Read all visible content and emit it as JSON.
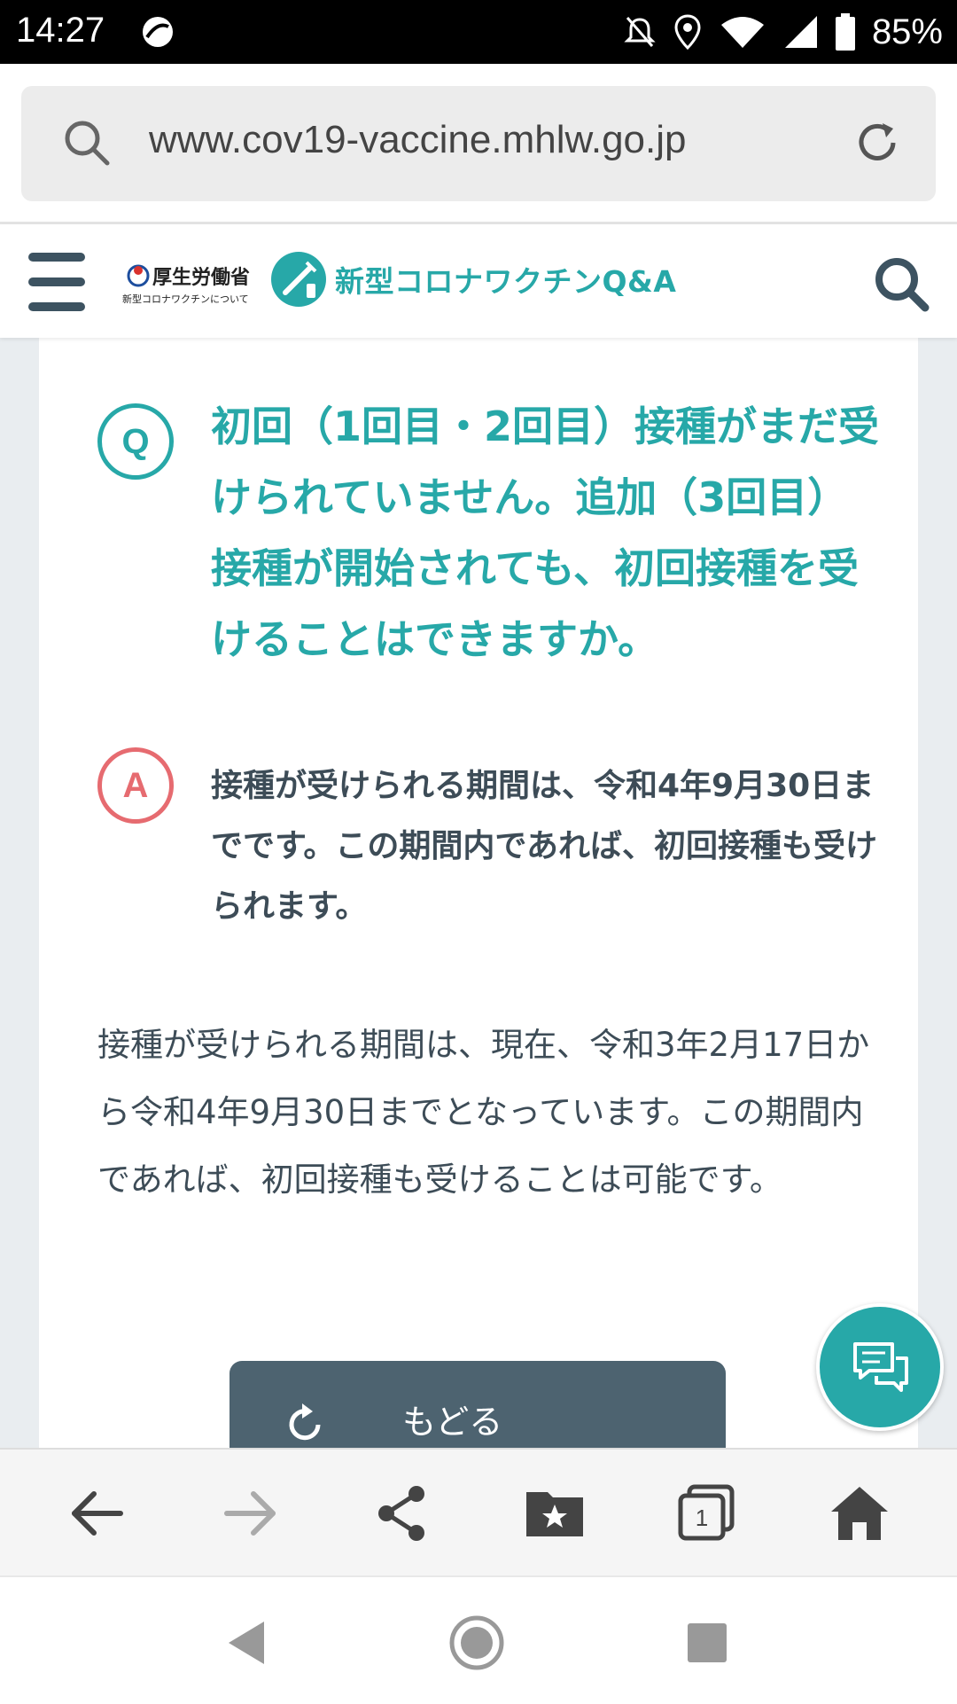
{
  "status_bar": {
    "time": "14:27",
    "battery": "85%"
  },
  "browser": {
    "url": "www.cov19-vaccine.mhlw.go.jp"
  },
  "site_header": {
    "mhlw_name": "厚生労働省",
    "mhlw_sub": "新型コロナワクチンについて",
    "site_title": "新型コロナワクチンQ&A"
  },
  "qa": {
    "q_badge": "Q",
    "question": "初回（1回目・2回目）接種がまだ受けられていません。追加（3回目）接種が開始されても、初回接種を受けることはできますか。",
    "a_badge": "A",
    "answer_lead": "接種が受けられる期間は、令和4年9月30日までです。この期間内であれば、初回接種も受けられます。",
    "answer_body": "接種が受けられる期間は、現在、令和3年2月17日から令和4年9月30日までとなっています。この期間内であれば、初回接種も受けることは可能です。"
  },
  "back_button": {
    "label": "もどる"
  },
  "colors": {
    "teal": "#27a8a8",
    "red": "#e66b70",
    "slate": "#4d6370"
  }
}
